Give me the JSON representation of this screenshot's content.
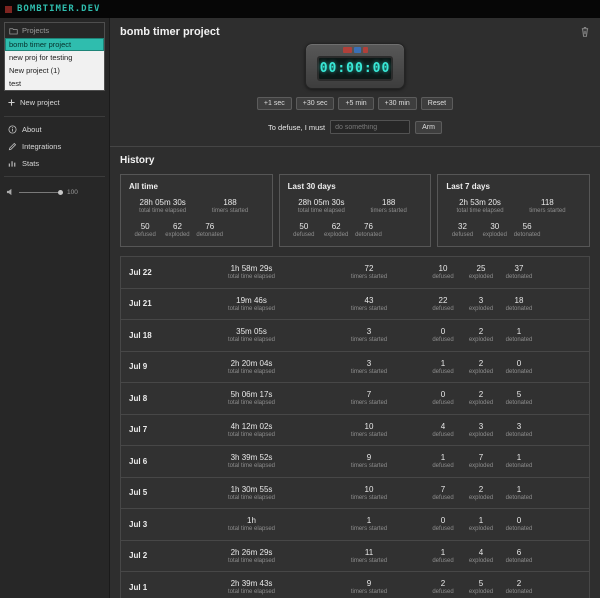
{
  "colors": {
    "accent": "#2fbdae",
    "timer_digits": "#38e8d6",
    "wire_red": "#b0403a",
    "wire_blue": "#3a6fb5"
  },
  "app": {
    "logo": "BOMBTIMER.DEV"
  },
  "sidebar": {
    "projects_header": "Projects",
    "projects": [
      {
        "label": "bomb timer project",
        "selected": true
      },
      {
        "label": "new proj for testing",
        "selected": false
      },
      {
        "label": "New project (1)",
        "selected": false
      },
      {
        "label": "test",
        "selected": false
      }
    ],
    "new_project_label": "New project",
    "nav": [
      {
        "label": "About",
        "icon": "info-icon"
      },
      {
        "label": "Integrations",
        "icon": "pencil-icon"
      },
      {
        "label": "Stats",
        "icon": "bar-chart-icon"
      }
    ],
    "volume": {
      "value": "100"
    }
  },
  "main": {
    "title": "bomb timer project",
    "timer": {
      "display": "00:00:00"
    },
    "timer_buttons": [
      "+1 sec",
      "+30 sec",
      "+5 min",
      "+30 min",
      "Reset"
    ],
    "defuse": {
      "label": "To defuse, I must",
      "placeholder": "do something",
      "arm_label": "Arm"
    },
    "history": {
      "title": "History",
      "captions": {
        "time": "total time elapsed",
        "timers": "timers started",
        "defused": "defused",
        "exploded": "exploded",
        "detonated": "detonated"
      },
      "summary_cards": [
        {
          "title": "All time",
          "time": "28h 05m 30s",
          "timers": "188",
          "defused": "50",
          "exploded": "62",
          "detonated": "76"
        },
        {
          "title": "Last 30 days",
          "time": "28h 05m 30s",
          "timers": "188",
          "defused": "50",
          "exploded": "62",
          "detonated": "76"
        },
        {
          "title": "Last 7 days",
          "time": "2h 53m 20s",
          "timers": "118",
          "defused": "32",
          "exploded": "30",
          "detonated": "56"
        }
      ],
      "rows": [
        {
          "date": "Jul 22",
          "time": "1h 58m 29s",
          "timers": "72",
          "defused": "10",
          "exploded": "25",
          "detonated": "37"
        },
        {
          "date": "Jul 21",
          "time": "19m 46s",
          "timers": "43",
          "defused": "22",
          "exploded": "3",
          "detonated": "18"
        },
        {
          "date": "Jul 18",
          "time": "35m 05s",
          "timers": "3",
          "defused": "0",
          "exploded": "2",
          "detonated": "1"
        },
        {
          "date": "Jul 9",
          "time": "2h 20m 04s",
          "timers": "3",
          "defused": "1",
          "exploded": "2",
          "detonated": "0"
        },
        {
          "date": "Jul 8",
          "time": "5h 06m 17s",
          "timers": "7",
          "defused": "0",
          "exploded": "2",
          "detonated": "5"
        },
        {
          "date": "Jul 7",
          "time": "4h 12m 02s",
          "timers": "10",
          "defused": "4",
          "exploded": "3",
          "detonated": "3"
        },
        {
          "date": "Jul 6",
          "time": "3h 39m 52s",
          "timers": "9",
          "defused": "1",
          "exploded": "7",
          "detonated": "1"
        },
        {
          "date": "Jul 5",
          "time": "1h 30m 55s",
          "timers": "10",
          "defused": "7",
          "exploded": "2",
          "detonated": "1"
        },
        {
          "date": "Jul 3",
          "time": "1h",
          "timers": "1",
          "defused": "0",
          "exploded": "1",
          "detonated": "0"
        },
        {
          "date": "Jul 2",
          "time": "2h 26m 29s",
          "timers": "11",
          "defused": "1",
          "exploded": "4",
          "detonated": "6"
        },
        {
          "date": "Jul 1",
          "time": "2h 39m 43s",
          "timers": "9",
          "defused": "2",
          "exploded": "5",
          "detonated": "2"
        }
      ]
    }
  }
}
